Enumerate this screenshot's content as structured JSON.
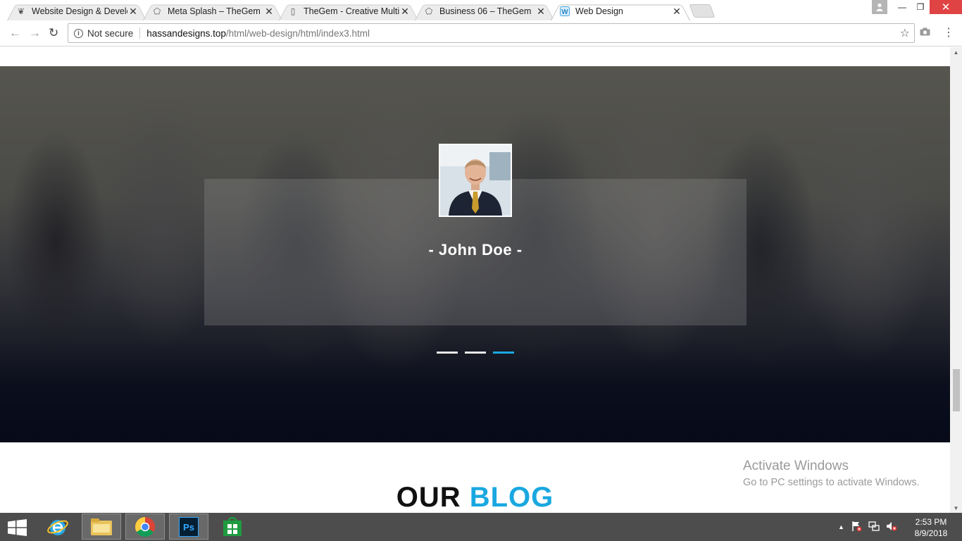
{
  "browser": {
    "tabs": [
      {
        "title": "Website Design & Develo",
        "favicon": "quill-icon"
      },
      {
        "title": "Meta Splash – TheGem",
        "favicon": "gem-icon"
      },
      {
        "title": "TheGem - Creative Multi-",
        "favicon": "page-icon"
      },
      {
        "title": "Business 06 – TheGem",
        "favicon": "gem-icon"
      },
      {
        "title": "Web Design",
        "favicon": "w-icon",
        "active": true
      }
    ],
    "security_label": "Not secure",
    "url_host": "hassandesigns.top",
    "url_path": "/html/web-design/html/index3.html"
  },
  "testimonial": {
    "name": "- John Doe -",
    "slides_total": 3,
    "active_slide": 3
  },
  "blog": {
    "heading_word1": "OUR",
    "heading_word2": "BLOG"
  },
  "watermark": {
    "line1": "Activate Windows",
    "line2": "Go to PC settings to activate Windows."
  },
  "taskbar": {
    "time": "2:53 PM",
    "date": "8/9/2018"
  },
  "colors": {
    "accent": "#1aa8e0",
    "taskbar": "#4d4d4d"
  }
}
